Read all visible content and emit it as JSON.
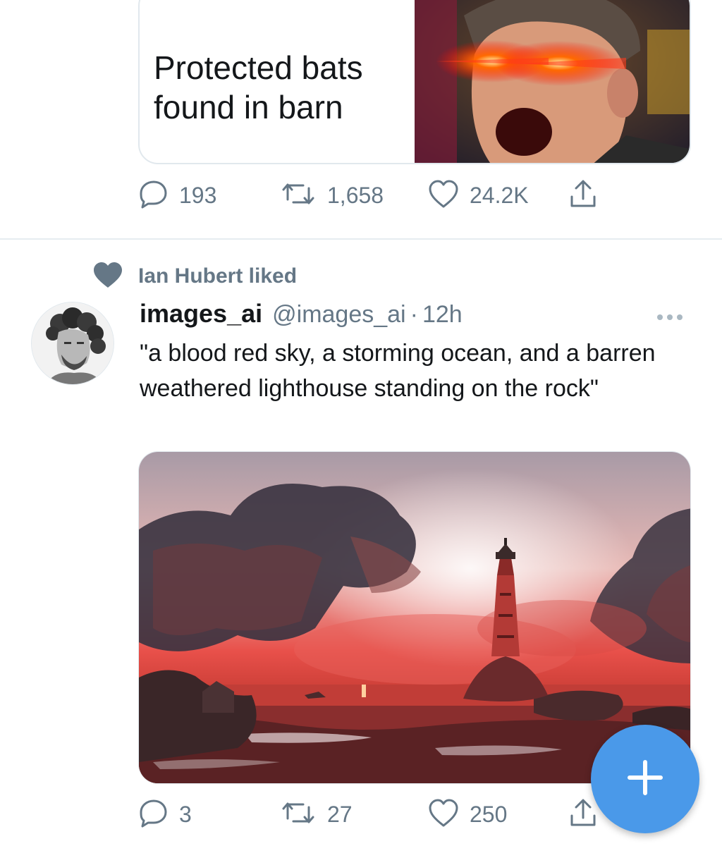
{
  "top_tweet": {
    "card_title": "Protected bats found in barn",
    "actions": {
      "reply_count": "193",
      "retweet_count": "1,658",
      "like_count": "24.2K"
    }
  },
  "tweet": {
    "social_context": "Ian Hubert liked",
    "display_name": "images_ai",
    "handle": "@images_ai",
    "separator": "·",
    "timestamp": "12h",
    "text": "\"a blood red sky, a storming ocean, and a barren weathered lighthouse standing on the rock\"",
    "actions": {
      "reply_count": "3",
      "retweet_count": "27",
      "like_count": "250"
    }
  },
  "colors": {
    "accent": "#4a99e9",
    "secondary_text": "#657786",
    "icon": "#657786",
    "divider": "#e6ecf0"
  },
  "icons": [
    "reply-icon",
    "retweet-icon",
    "like-icon",
    "share-icon",
    "heart-filled-icon",
    "more-icon",
    "compose-plus-icon"
  ]
}
